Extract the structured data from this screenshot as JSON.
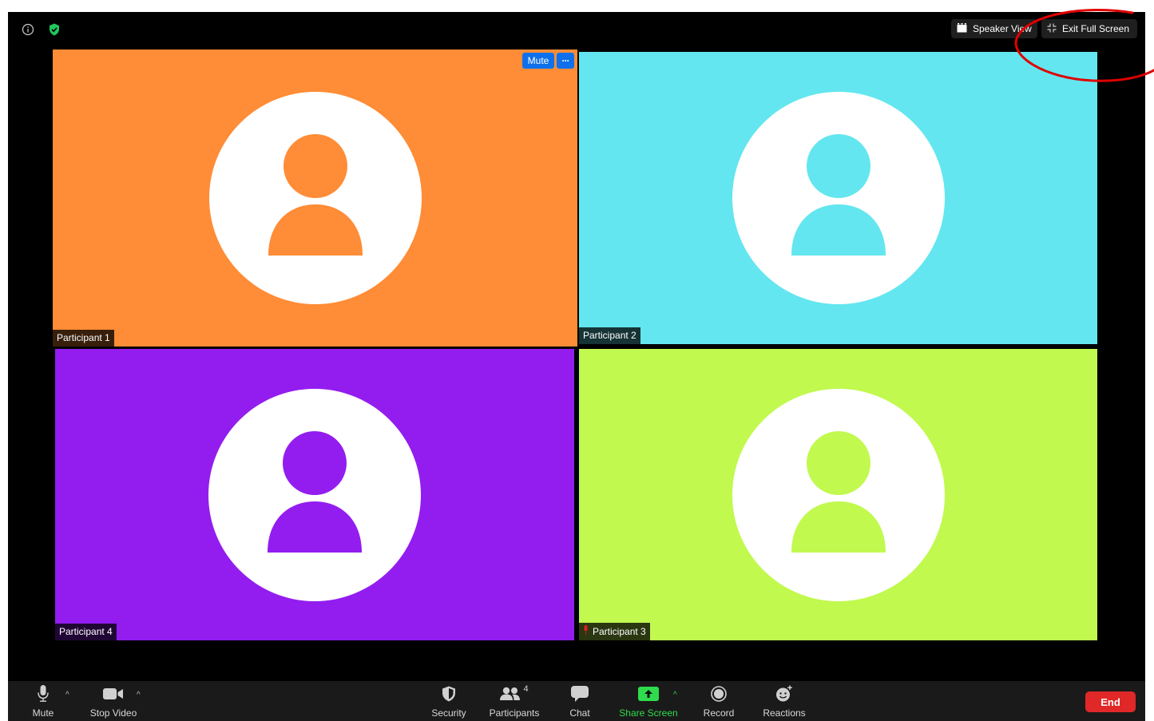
{
  "top_bar": {
    "speaker_view_label": "Speaker View",
    "exit_full_screen_label": "Exit Full Screen"
  },
  "tiles": [
    {
      "name": "Participant 1",
      "color": "#ff8c36",
      "active": true,
      "mute_label": "Mute",
      "more_label": "···"
    },
    {
      "name": "Participant 2",
      "color": "#63e6ef"
    },
    {
      "name": "Participant 4",
      "color": "#931def"
    },
    {
      "name": "Participant 3",
      "color": "#c1f94f",
      "mic_muted": true
    }
  ],
  "toolbar": {
    "mute_label": "Mute",
    "stop_video_label": "Stop Video",
    "security_label": "Security",
    "participants_label": "Participants",
    "participants_count": "4",
    "chat_label": "Chat",
    "share_screen_label": "Share Screen",
    "record_label": "Record",
    "reactions_label": "Reactions",
    "end_label": "End"
  },
  "colors": {
    "window_bg": "#000000",
    "toolbar_bg": "#1a1a1a",
    "active_speaker_border": "#d6f08a",
    "zoom_blue": "#0e71eb",
    "share_green": "#2fdc4e",
    "end_red": "#e02828",
    "annotation_red": "#e00000"
  }
}
